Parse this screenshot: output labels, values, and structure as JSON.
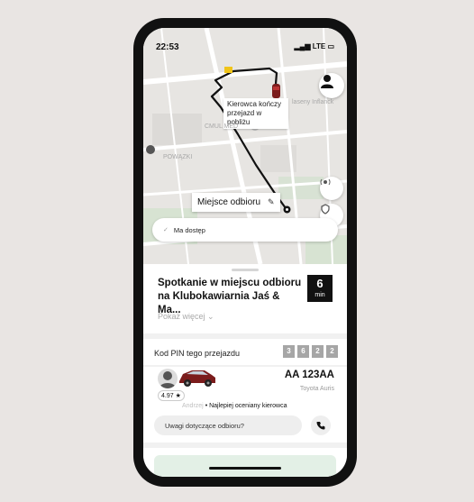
{
  "status_bar": {
    "time": "22:53",
    "network": "LTE"
  },
  "map": {
    "driver_label": "Kierowca kończy przejazd w pobliżu",
    "pickup_label": "Miejsce odbioru",
    "streets": [
      "CMUL MED",
      "POWĄZKI",
      "laseny Inflanck"
    ],
    "access_status": "Ma dostęp"
  },
  "sheet": {
    "headline": "Spotkanie w miejscu odbioru na Klubokawiarnia Jaś & Ma...",
    "eta_value": "6",
    "eta_unit": "min",
    "show_more": "Pokaż więcej",
    "pin_label": "Kod PIN tego przejazdu",
    "pin_digits": [
      "3",
      "6",
      "2",
      "2"
    ],
    "driver": {
      "rating": "4.97",
      "name": "Andrzej",
      "badge": "Najlepiej oceniany kierowca",
      "plate": "AA 123AA",
      "car_model": "Toyota Auris"
    },
    "note_placeholder": "Uwagi dotyczące odbioru?"
  },
  "colors": {
    "route": "#111111",
    "car": "#7b1c1c",
    "bottom_card": "#e3f0e6"
  }
}
